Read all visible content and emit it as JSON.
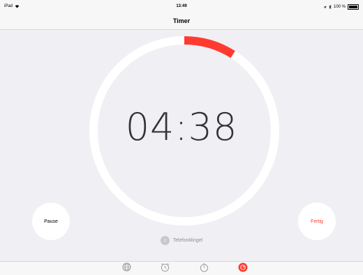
{
  "status_bar": {
    "device": "iPad",
    "time": "13:49",
    "battery": "100 %"
  },
  "nav": {
    "title": "Timer"
  },
  "timer": {
    "remaining": "04:38",
    "elapsed_fraction": 0.09,
    "progress_color": "#ff3b30",
    "track_color": "#ffffff"
  },
  "buttons": {
    "pause_label": "Pause",
    "done_label": "Fertig",
    "done_color": "#ff3b30"
  },
  "sound": {
    "label": "Telefonklingel",
    "icon": "music-note-icon"
  },
  "tabs": [
    {
      "icon": "globe-icon",
      "active": false
    },
    {
      "icon": "alarm-clock-icon",
      "active": false
    },
    {
      "icon": "stopwatch-icon",
      "active": false
    },
    {
      "icon": "timer-icon",
      "active": true
    }
  ]
}
